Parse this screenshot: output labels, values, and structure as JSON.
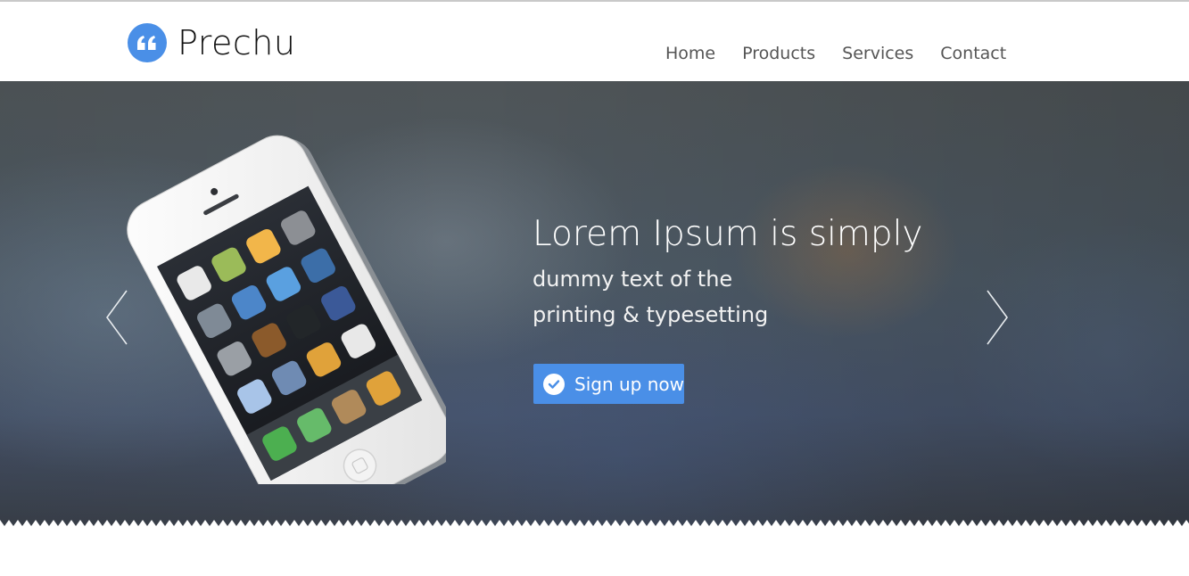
{
  "brand": {
    "name": "Prechu",
    "accent_color": "#4a8fe7",
    "logo_icon": "quote-icon"
  },
  "nav": {
    "items": [
      {
        "label": "Home"
      },
      {
        "label": "Products"
      },
      {
        "label": "Services"
      },
      {
        "label": "Contact"
      }
    ]
  },
  "hero": {
    "headline": "Lorem Ipsum is simply",
    "subline_1": "dummy text of the",
    "subline_2": "printing & typesetting",
    "cta": {
      "label": "Sign up now",
      "icon": "check-circle-icon"
    },
    "prev_icon": "chevron-left-icon",
    "next_icon": "chevron-right-icon",
    "device_image": "smartphone-image"
  }
}
